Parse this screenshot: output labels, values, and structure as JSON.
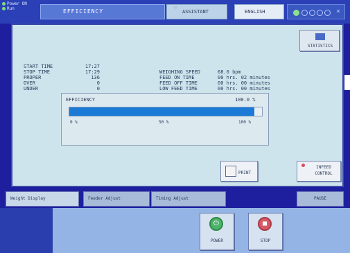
{
  "header": {
    "power_label": "Power ON",
    "run_label": "Run",
    "title": "EFFICIENCY",
    "assistant_label": "ASSISTANT",
    "language": "ENGLISH"
  },
  "statistics_button": {
    "label": "STATISTICS"
  },
  "info": {
    "left": [
      {
        "label": "START TIME",
        "value": "17:27"
      },
      {
        "label": "STOP TIME",
        "value": "17:29"
      },
      {
        "label": "PROPER",
        "value": "136"
      },
      {
        "label": "OVER",
        "value": "0"
      },
      {
        "label": "UNDER",
        "value": "0"
      }
    ],
    "right": [
      {
        "label": "WEIGHING SPEED",
        "value": "68.0 bpm"
      },
      {
        "label": "FEED ON TIME",
        "value": "00 hrs. 02 minutes"
      },
      {
        "label": "FEED OFF TIME",
        "value": "00 hrs. 00 minutes"
      },
      {
        "label": "LOW FEED TIME",
        "value": "00 hrs. 00 minutes"
      }
    ]
  },
  "efficiency": {
    "label": "EFFICIENCY",
    "value_text": "100.0 %",
    "fraction": 0.96,
    "scale_min": "0 %",
    "scale_mid": "50 %",
    "scale_max": "100 %"
  },
  "buttons": {
    "print": "PRINT",
    "infeed_line1": "INFEED",
    "infeed_line2": "CONTROL",
    "power": "POWER",
    "stop": "STOP",
    "pause": "PAUSE"
  },
  "tabs": [
    {
      "label": "Weight Display"
    },
    {
      "label": "Feeder Adjust"
    },
    {
      "label": "Timing Adjust"
    }
  ],
  "colors": {
    "accent": "#1a7ad6",
    "frame": "#1d1f9e",
    "panel": "#cde4ec"
  }
}
